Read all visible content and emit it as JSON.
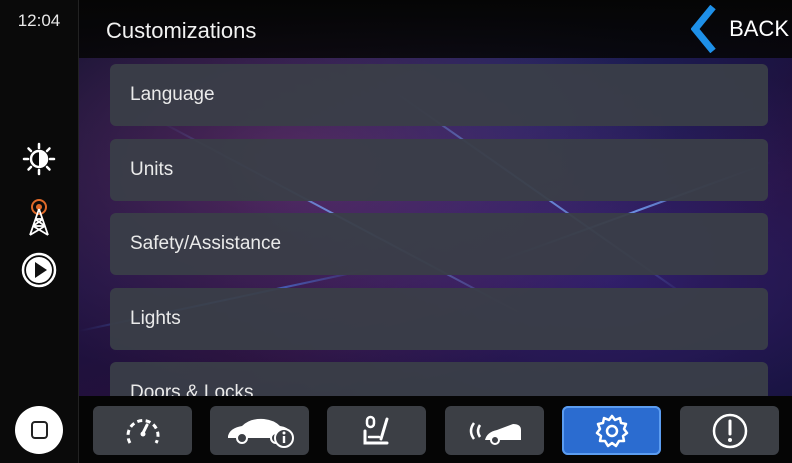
{
  "status": {
    "time": "12:04"
  },
  "header": {
    "title": "Customizations",
    "back_label": "BACK"
  },
  "menu": {
    "items": [
      {
        "label": "Language"
      },
      {
        "label": "Units"
      },
      {
        "label": "Safety/Assistance"
      },
      {
        "label": "Lights"
      },
      {
        "label": "Doors & Locks"
      }
    ]
  },
  "sidebar_icons": [
    "brightness-icon",
    "radio-tower-icon",
    "play-icon",
    "home-icon"
  ],
  "bottom_nav": [
    "gauge-icon",
    "car-info-icon",
    "seat-icon",
    "parking-sensor-icon",
    "settings-icon",
    "alert-icon"
  ],
  "active_nav": "settings-icon",
  "colors": {
    "accent": "#2b6cd0",
    "back_arrow": "#1e90e8",
    "tile": "#3a3e48"
  }
}
